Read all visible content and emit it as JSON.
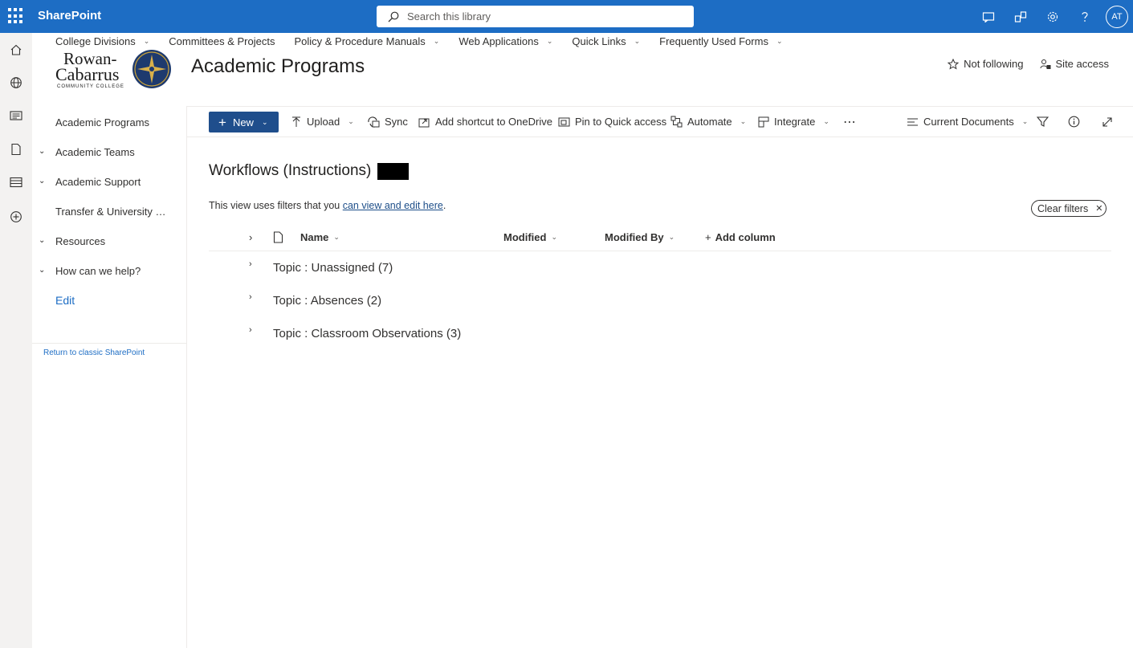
{
  "suite": {
    "app_name": "SharePoint",
    "search_placeholder": "Search this library",
    "avatar_initials": "AT",
    "icons": [
      "app-launcher-icon",
      "feedback-icon",
      "share-icon",
      "settings-icon",
      "help-icon"
    ]
  },
  "rail": {
    "icons": [
      "home-icon",
      "globe-icon",
      "news-icon",
      "files-icon",
      "lists-icon",
      "create-icon"
    ]
  },
  "hub_nav": {
    "items": [
      {
        "label": "College Divisions",
        "has_menu": true
      },
      {
        "label": "Committees & Projects",
        "has_menu": false
      },
      {
        "label": "Policy & Procedure Manuals",
        "has_menu": true
      },
      {
        "label": "Web Applications",
        "has_menu": true
      },
      {
        "label": "Quick Links",
        "has_menu": true
      },
      {
        "label": "Frequently Used Forms",
        "has_menu": true
      }
    ]
  },
  "site": {
    "logo_text_line1": "Rowan-",
    "logo_text_line2": "Cabarrus",
    "logo_text_line3": "COMMUNITY COLLEGE",
    "title": "Academic Programs",
    "follow_label": "Not following",
    "site_access_label": "Site access"
  },
  "left_nav": {
    "items": [
      {
        "label": "Academic Programs",
        "expandable": false
      },
      {
        "label": "Academic Teams",
        "expandable": true
      },
      {
        "label": "Academic Support",
        "expandable": true
      },
      {
        "label": "Transfer & University Partnerships",
        "expandable": false
      },
      {
        "label": "Resources",
        "expandable": true
      },
      {
        "label": "How can we help?",
        "expandable": true
      }
    ],
    "edit_label": "Edit",
    "classic_label": "Return to classic SharePoint"
  },
  "command_bar": {
    "new_label": "New",
    "upload_label": "Upload",
    "sync_label": "Sync",
    "shortcut_label": "Add shortcut to OneDrive",
    "pin_label": "Pin to Quick access",
    "automate_label": "Automate",
    "integrate_label": "Integrate",
    "more_label": "⋯",
    "view_label": "Current Documents"
  },
  "library": {
    "title": "Workflows (Instructions)",
    "filter_msg_prefix": "This view uses filters that you ",
    "filter_msg_link": "can view and edit here",
    "filter_msg_suffix": ".",
    "clear_filters_label": "Clear filters",
    "columns": {
      "name": "Name",
      "modified": "Modified",
      "modified_by": "Modified By",
      "add_column": "Add column"
    },
    "groups": [
      {
        "label": "Topic : Unassigned (7)"
      },
      {
        "label": "Topic : Absences (2)"
      },
      {
        "label": "Topic : Classroom Observations (3)"
      }
    ]
  },
  "colors": {
    "suite_bar": "#1d6dc4",
    "primary_button": "#1f4e8c",
    "link": "#1d6dc4"
  }
}
